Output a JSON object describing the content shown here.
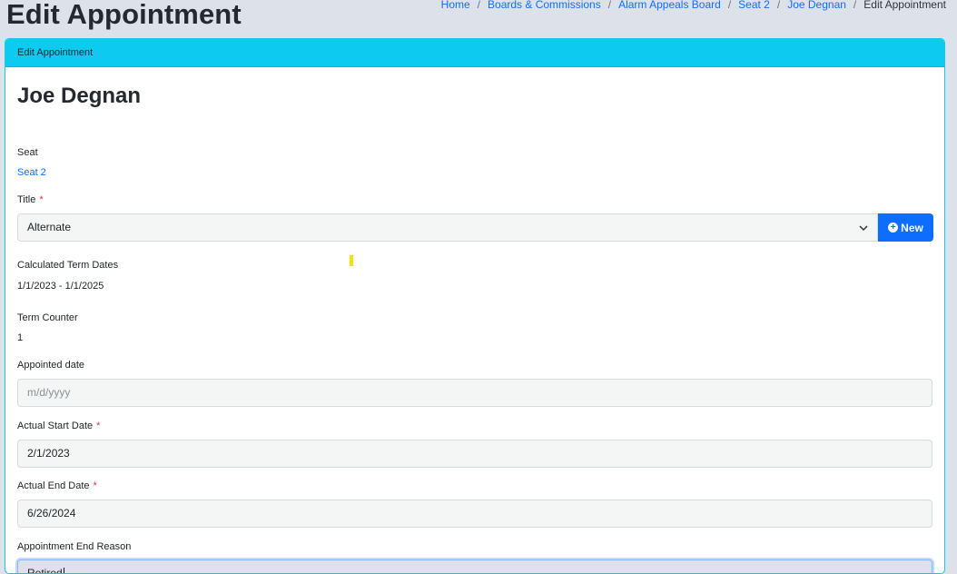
{
  "page": {
    "title": "Edit Appointment"
  },
  "breadcrumb": [
    {
      "label": "Home"
    },
    {
      "label": "Boards & Commissions"
    },
    {
      "label": "Alarm Appeals Board"
    },
    {
      "label": "Seat 2"
    },
    {
      "label": "Joe Degnan"
    },
    {
      "label": "Edit Appointment"
    }
  ],
  "breadcrumb_separator": "/",
  "card": {
    "header": "Edit Appointment",
    "person_name": "Joe Degnan"
  },
  "seat": {
    "label": "Seat",
    "value": "Seat 2"
  },
  "title_field": {
    "label": "Title",
    "required_mark": "*",
    "value": "Alternate",
    "new_button": "New"
  },
  "term_dates": {
    "label": "Calculated Term Dates",
    "value": "1/1/2023 - 1/1/2025"
  },
  "term_counter": {
    "label": "Term Counter",
    "value": "1"
  },
  "appointed_date": {
    "label": "Appointed date",
    "placeholder": "m/d/yyyy",
    "value": ""
  },
  "start_date": {
    "label": "Actual Start Date",
    "required_mark": "*",
    "value": "2/1/2023"
  },
  "end_date": {
    "label": "Actual End Date",
    "required_mark": "*",
    "value": "6/26/2024"
  },
  "end_reason": {
    "label": "Appointment End Reason",
    "value": "Retired"
  },
  "colors": {
    "header_bg": "#0dcaf0",
    "primary": "#0d6efd",
    "required": "#dc3545",
    "page_bg": "#dde2ea"
  },
  "icons": {
    "select_chevron": "chevron-down-icon",
    "new_icon": "plus-circle-icon"
  }
}
